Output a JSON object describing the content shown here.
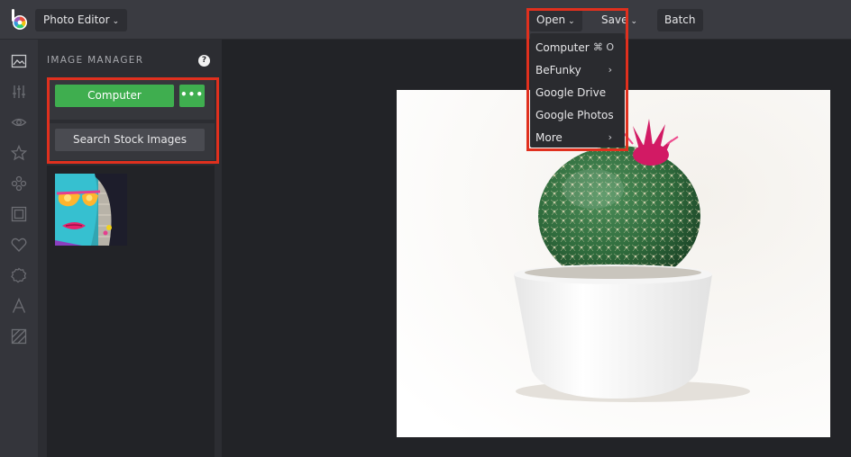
{
  "topbar": {
    "app_menu": "Photo Editor",
    "open_label": "Open",
    "save_label": "Save",
    "batch_label": "Batch"
  },
  "rail": {
    "icons": [
      "image-icon",
      "sliders-icon",
      "eye-icon",
      "star-icon",
      "effects-icon",
      "frame-icon",
      "heart-icon",
      "badge-icon",
      "text-icon",
      "texture-icon"
    ]
  },
  "panel": {
    "title": "IMAGE MANAGER",
    "help": "?",
    "computer_button": "Computer",
    "more_button": "•••",
    "stock_button": "Search Stock Images"
  },
  "dropdown": {
    "items": [
      {
        "label": "Computer",
        "shortcut": "⌘ O"
      },
      {
        "label": "BeFunky",
        "arrow": "›"
      },
      {
        "label": "Google Drive"
      },
      {
        "label": "Google Photos"
      },
      {
        "label": "More",
        "arrow": "›"
      }
    ]
  },
  "colors": {
    "accent_green": "#3fae4f",
    "highlight_red": "#e0301e",
    "topbar": "#3a3b41"
  }
}
